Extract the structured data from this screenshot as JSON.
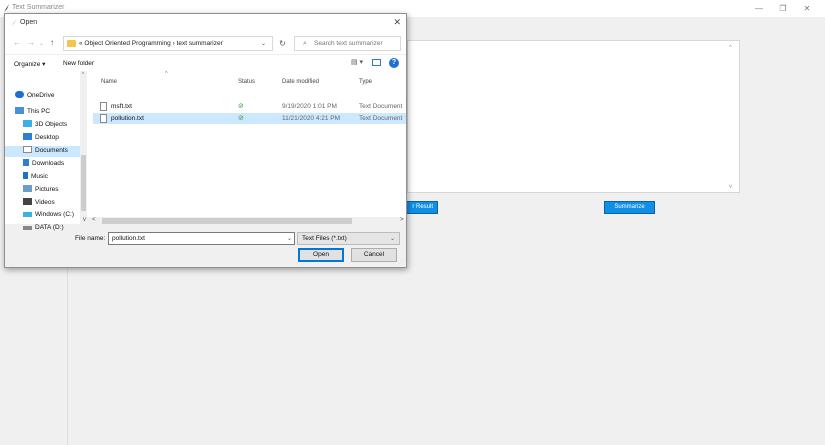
{
  "app": {
    "title": "Text Summarizer",
    "minimize": "—",
    "maximize": "❐",
    "close": "✕",
    "clear_result_label": "r Result",
    "summarize_label": "Summarize",
    "scroll_up": "^",
    "scroll_down": "v"
  },
  "dialog": {
    "title": "Open",
    "close": "✕",
    "nav": {
      "back": "←",
      "forward": "→",
      "recent": "⌄",
      "up": "↑"
    },
    "address": "« Object Oriented Programming  ›  text summarizer",
    "address_chevron": "⌄",
    "refresh": "↻",
    "search_placeholder": "Search text summarizer",
    "toolbar": {
      "organize": "Organize ▾",
      "new_folder": "New folder",
      "view": "▤ ▾",
      "help": "?"
    },
    "nav_pane": [
      {
        "label": "OneDrive",
        "color": "#1e70d0"
      },
      {
        "label": "This PC",
        "color": "#4a90d9"
      },
      {
        "label": "3D Objects",
        "color": "#3ab0e6"
      },
      {
        "label": "Desktop",
        "color": "#2d7fd6"
      },
      {
        "label": "Documents",
        "color": "#8a8a8a"
      },
      {
        "label": "Downloads",
        "color": "#2d7fd6"
      },
      {
        "label": "Music",
        "color": "#1e70d0"
      },
      {
        "label": "Pictures",
        "color": "#6d9ec9"
      },
      {
        "label": "Videos",
        "color": "#444444"
      },
      {
        "label": "Windows (C:)",
        "color": "#3ab0e6"
      },
      {
        "label": "DATA (D:)",
        "color": "#888888"
      }
    ],
    "columns": {
      "name": "Name",
      "status": "Status",
      "date": "Date modified",
      "type": "Type"
    },
    "sort_indicator": "^",
    "files": [
      {
        "name": "msft.txt",
        "status": "⊘",
        "date": "9/19/2020 1:01 PM",
        "type": "Text Document"
      },
      {
        "name": "pollution.txt",
        "status": "⊘",
        "date": "11/21/2020 4:21 PM",
        "type": "Text Document"
      }
    ],
    "scroll": {
      "left": "<",
      "right": ">",
      "up": "^",
      "down": "v"
    },
    "file_name_label": "File name:",
    "file_name_value": "pollution.txt",
    "file_name_chevron": "⌄",
    "filter_value": "Text Files (*.txt)",
    "filter_chevron": "⌄",
    "open_label": "Open",
    "cancel_label": "Cancel",
    "grip": "⋰"
  }
}
